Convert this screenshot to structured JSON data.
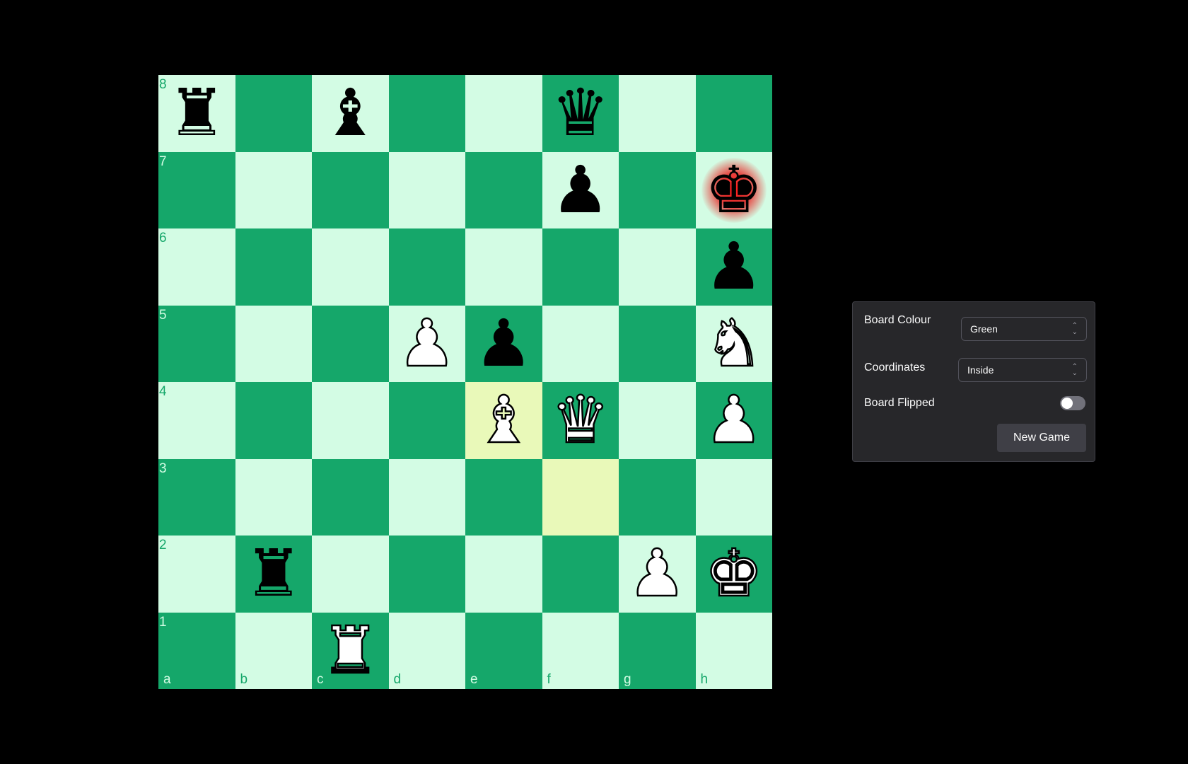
{
  "board": {
    "files": [
      "a",
      "b",
      "c",
      "d",
      "e",
      "f",
      "g",
      "h"
    ],
    "ranks": [
      "8",
      "7",
      "6",
      "5",
      "4",
      "3",
      "2",
      "1"
    ],
    "colors": {
      "light": "#d3fce4",
      "dark": "#15a76a",
      "highlight": "#e9f9b9",
      "check": "#e11d1d"
    },
    "pieces": [
      {
        "square": "a8",
        "color": "black",
        "type": "rook",
        "glyph": "♜"
      },
      {
        "square": "c8",
        "color": "black",
        "type": "bishop",
        "glyph": "♝"
      },
      {
        "square": "f8",
        "color": "black",
        "type": "queen",
        "glyph": "♛"
      },
      {
        "square": "f7",
        "color": "black",
        "type": "pawn",
        "glyph": "♟"
      },
      {
        "square": "h7",
        "color": "black",
        "type": "king",
        "glyph": "♚"
      },
      {
        "square": "h6",
        "color": "black",
        "type": "pawn",
        "glyph": "♟"
      },
      {
        "square": "d5",
        "color": "white",
        "type": "pawn",
        "glyph": "♟"
      },
      {
        "square": "e5",
        "color": "black",
        "type": "pawn",
        "glyph": "♟"
      },
      {
        "square": "h5",
        "color": "white",
        "type": "knight",
        "glyph": "♞"
      },
      {
        "square": "e4",
        "color": "white",
        "type": "bishop",
        "glyph": "♝"
      },
      {
        "square": "f4",
        "color": "white",
        "type": "queen",
        "glyph": "♛"
      },
      {
        "square": "h4",
        "color": "white",
        "type": "pawn",
        "glyph": "♟"
      },
      {
        "square": "b2",
        "color": "black",
        "type": "rook",
        "glyph": "♜"
      },
      {
        "square": "g2",
        "color": "white",
        "type": "pawn",
        "glyph": "♟"
      },
      {
        "square": "h2",
        "color": "white",
        "type": "king",
        "glyph": "♚"
      },
      {
        "square": "c1",
        "color": "white",
        "type": "rook",
        "glyph": "♜"
      }
    ],
    "last_move_squares": [
      "f3",
      "e4"
    ],
    "check_square": "h7"
  },
  "settings": {
    "board_colour_label": "Board Colour",
    "board_colour_value": "Green",
    "coordinates_label": "Coordinates",
    "coordinates_value": "Inside",
    "board_flipped_label": "Board Flipped",
    "board_flipped": false,
    "new_game_label": "New Game"
  }
}
